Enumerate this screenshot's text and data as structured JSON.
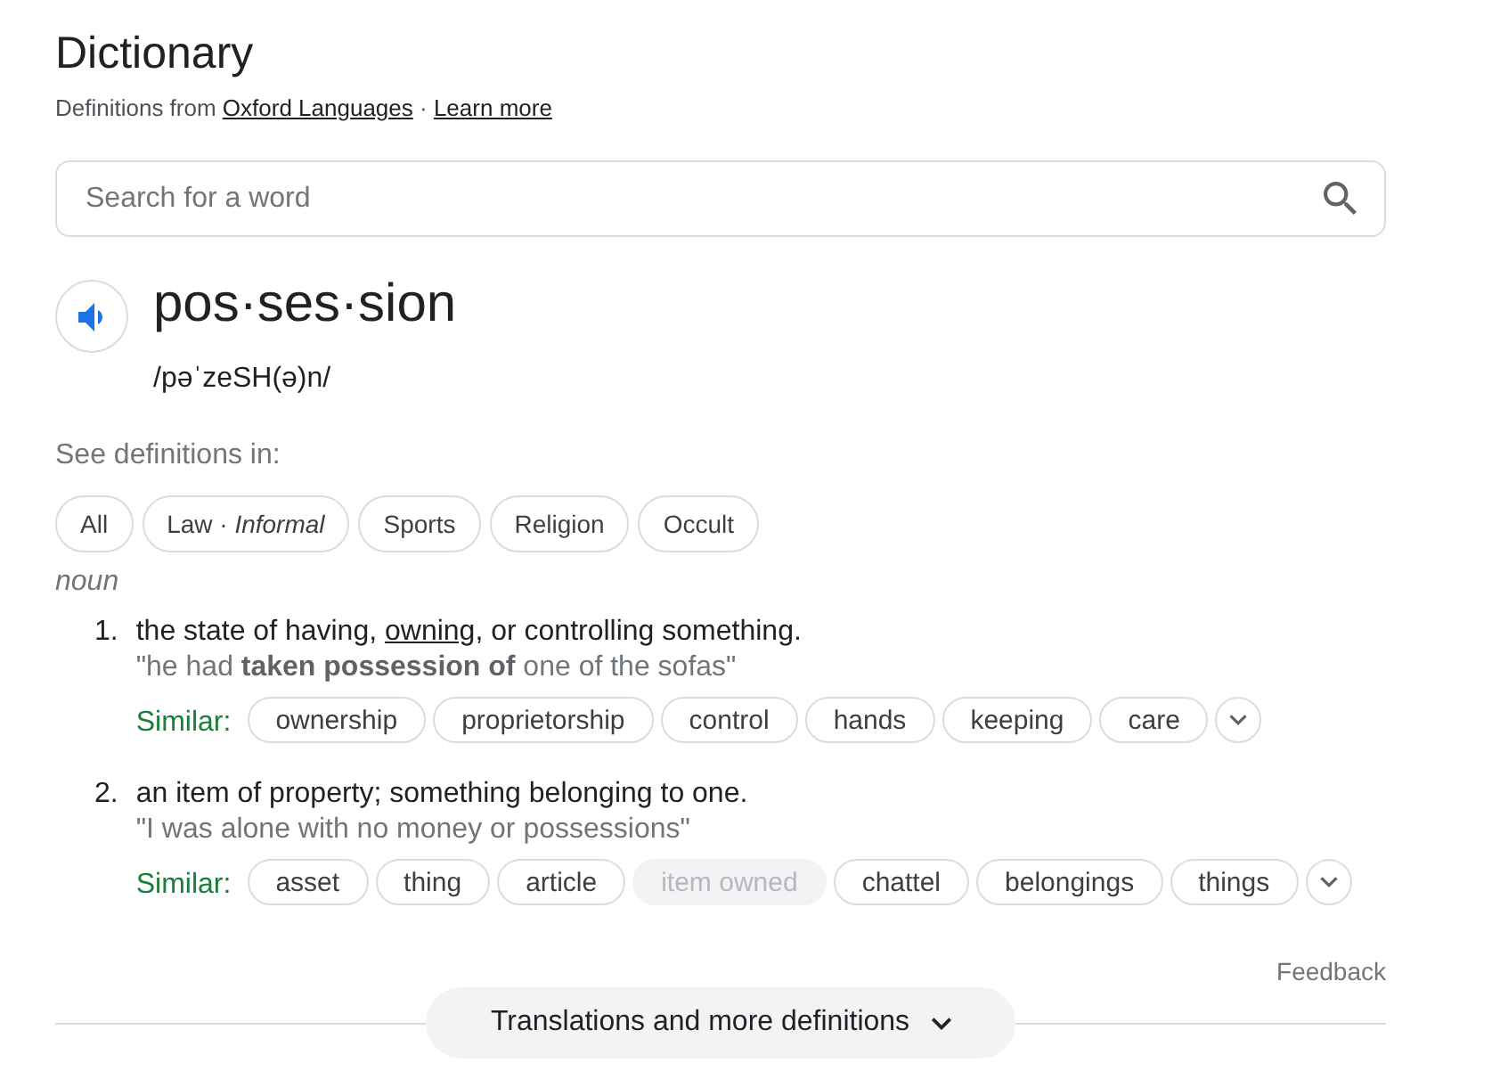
{
  "title": "Dictionary",
  "attribution": [
    {
      "kind": "plain",
      "text": "Definitions from "
    },
    {
      "kind": "link",
      "text": "Oxford Languages"
    },
    {
      "kind": "plain",
      "text": " · "
    },
    {
      "kind": "link",
      "text": "Learn more"
    }
  ],
  "search": {
    "placeholder": "Search for a word"
  },
  "entry": {
    "word": "pos·ses·sion",
    "phonetic": "/pəˈzeSH(ə)n/"
  },
  "see_definitions": {
    "label": "See definitions in:",
    "chips": [
      "All",
      "Law · *Informal*",
      "Sports",
      "Religion",
      "Occult"
    ]
  },
  "part_of_speech": "noun",
  "senses": [
    {
      "number": "1.",
      "definition": [
        {
          "kind": "plain",
          "text": "the state of having, "
        },
        {
          "kind": "link",
          "text": "owning"
        },
        {
          "kind": "plain",
          "text": ", or controlling something."
        }
      ],
      "example": "\"he had **taken possession of** one of the sofas\"",
      "similar_label": "Similar:",
      "similar": [
        {
          "word": "ownership",
          "disabled": false
        },
        {
          "word": "proprietorship",
          "disabled": false
        },
        {
          "word": "control",
          "disabled": false
        },
        {
          "word": "hands",
          "disabled": false
        },
        {
          "word": "keeping",
          "disabled": false
        },
        {
          "word": "care",
          "disabled": false
        }
      ]
    },
    {
      "number": "2.",
      "definition": [
        {
          "kind": "plain",
          "text": "an item of property; something belonging to one."
        }
      ],
      "example": "\"I was alone with no money or possessions\"",
      "similar_label": "Similar:",
      "similar": [
        {
          "word": "asset",
          "disabled": false
        },
        {
          "word": "thing",
          "disabled": false
        },
        {
          "word": "article",
          "disabled": false
        },
        {
          "word": "item owned",
          "disabled": true
        },
        {
          "word": "chattel",
          "disabled": false
        },
        {
          "word": "belongings",
          "disabled": false
        },
        {
          "word": "things",
          "disabled": false
        }
      ]
    }
  ],
  "feedback": "Feedback",
  "more_button": "Translations and more definitions"
}
